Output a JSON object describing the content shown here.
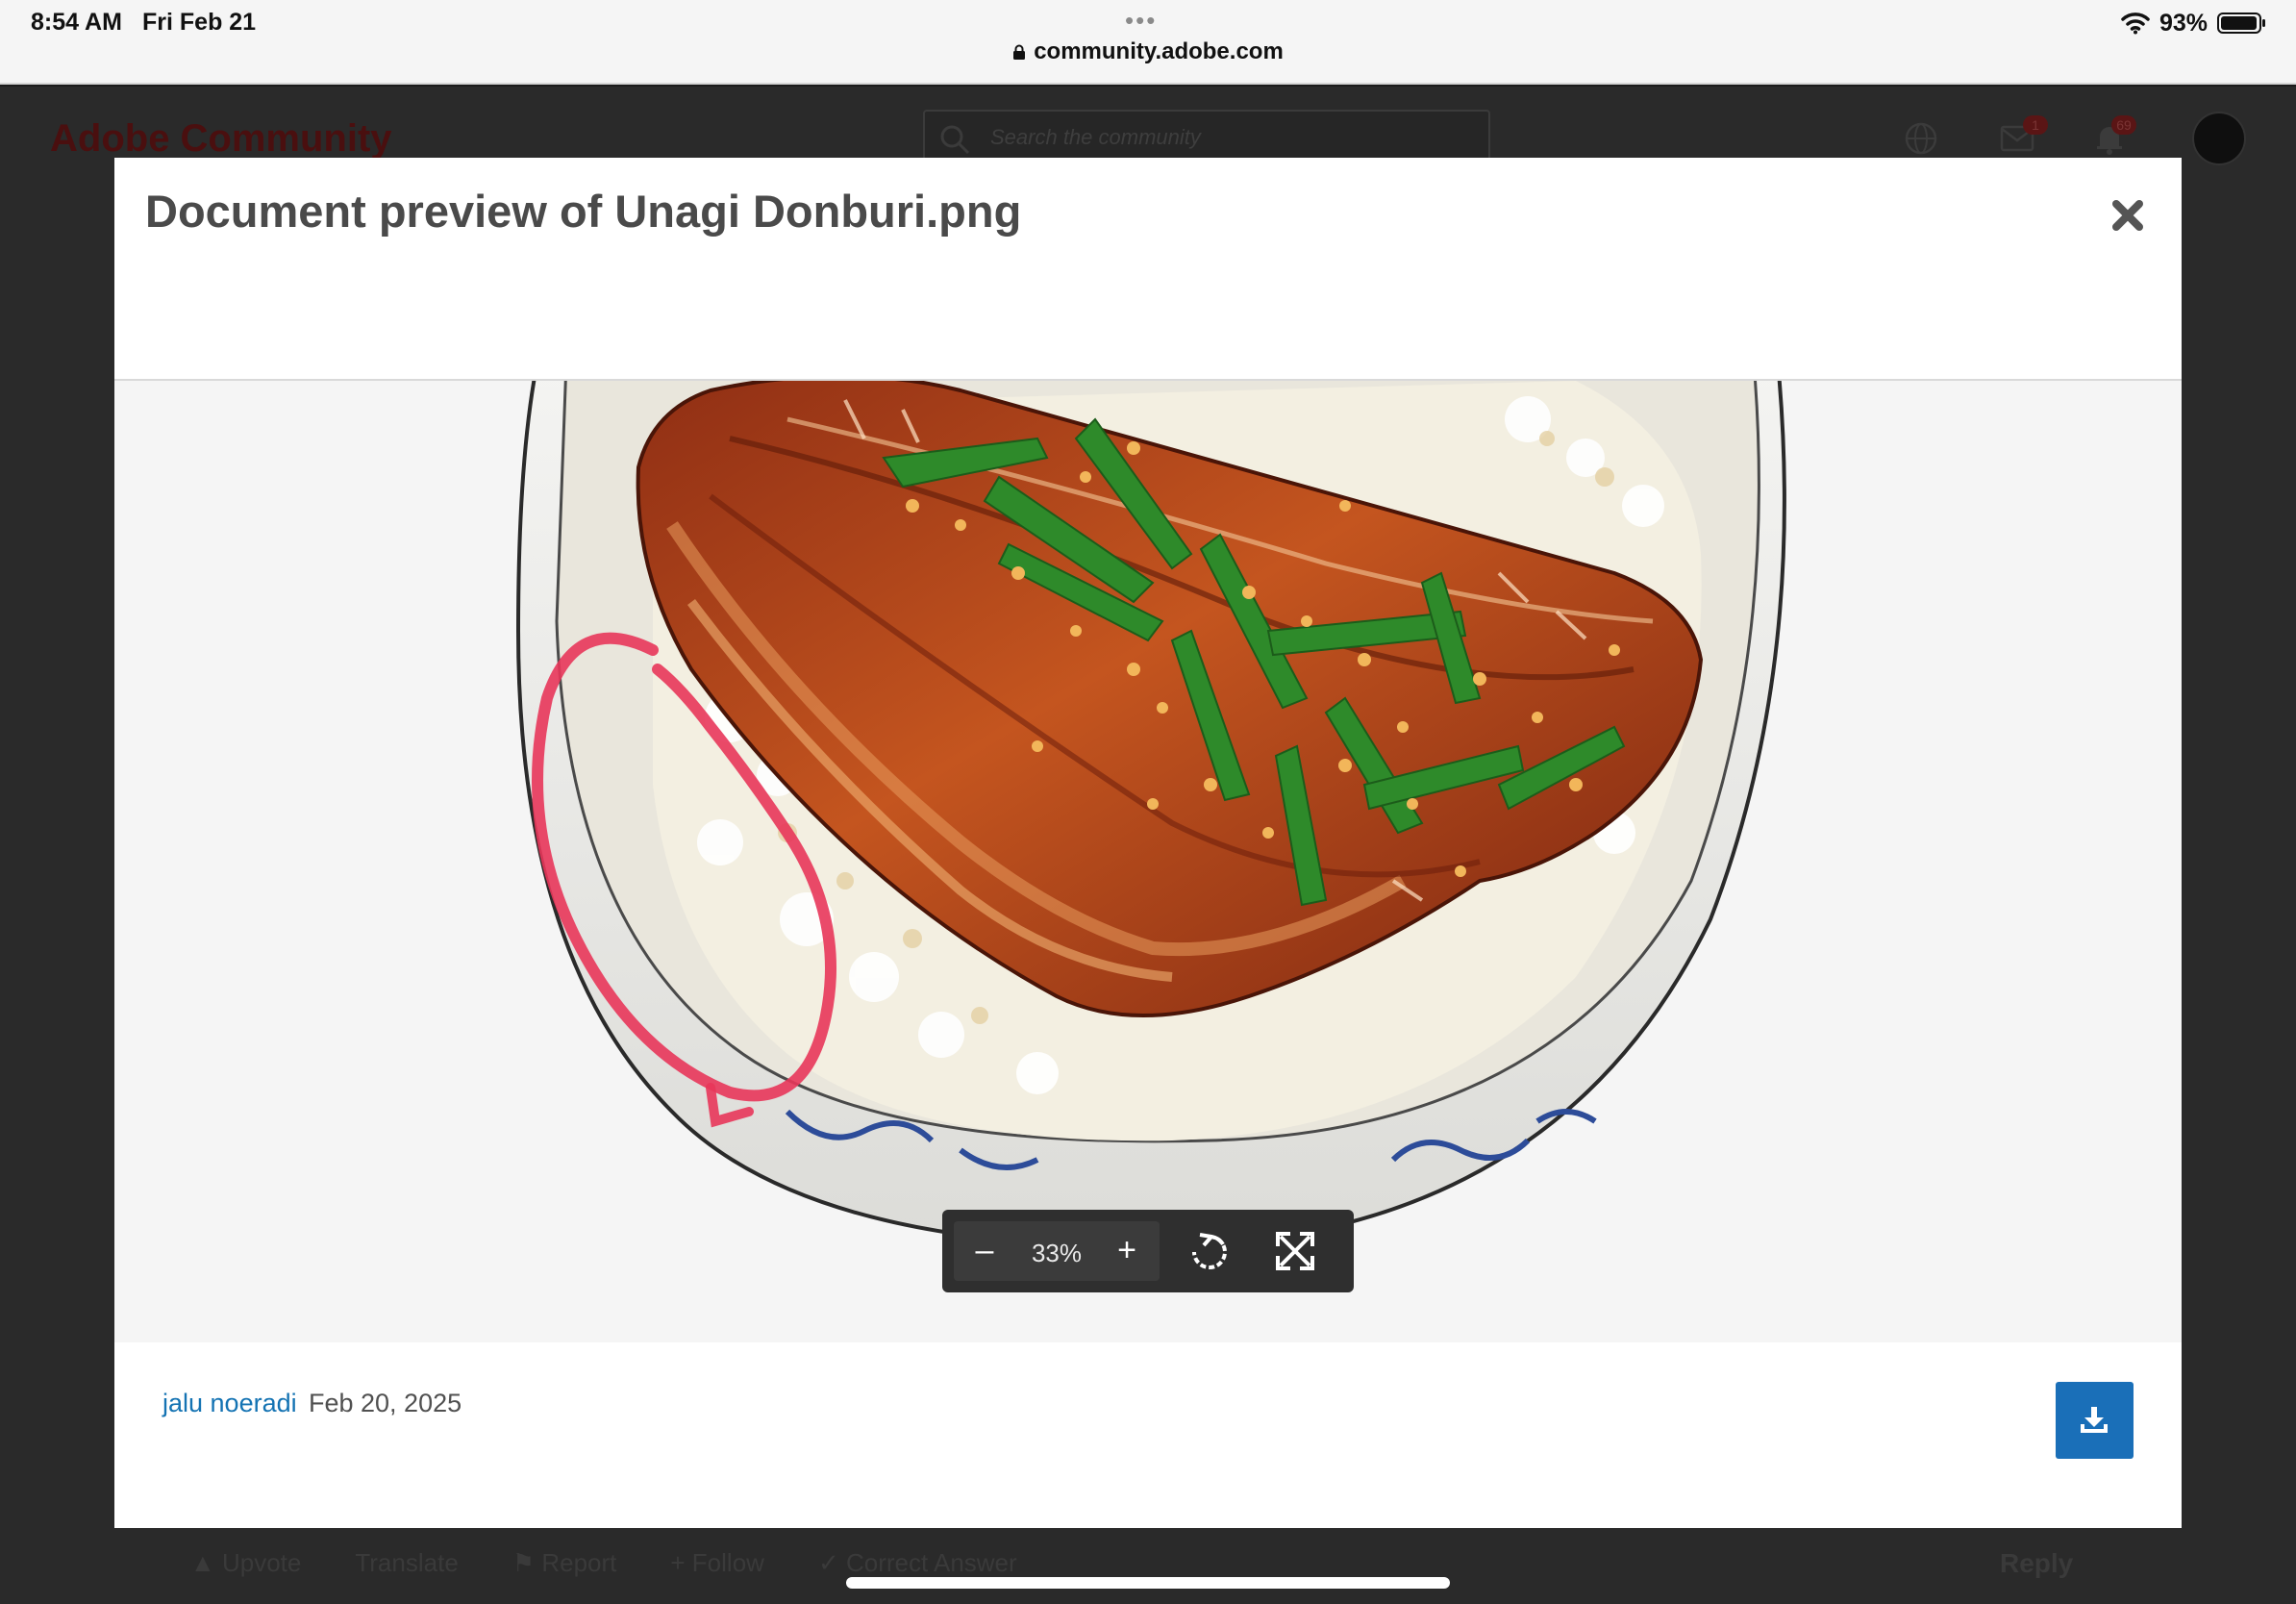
{
  "status_bar": {
    "time": "8:54 AM",
    "date": "Fri Feb 21",
    "url": "community.adobe.com",
    "battery": "93%"
  },
  "background_page": {
    "logo": "Adobe Community",
    "search_placeholder": "Search the community",
    "messages_badge": "1",
    "notifications_badge": "69",
    "actions": {
      "upvote": "Upvote",
      "translate": "Translate",
      "report": "Report",
      "follow": "Follow",
      "correct_answer": "Correct Answer",
      "reply": "Reply"
    }
  },
  "modal": {
    "title": "Document preview of Unagi Donburi.png",
    "zoom_level": "33%",
    "author": "jalu noeradi",
    "date": "Feb 20, 2025"
  },
  "colors": {
    "link": "#1473b3",
    "download_button": "#1a6fb8",
    "annotation": "#e8365a"
  }
}
